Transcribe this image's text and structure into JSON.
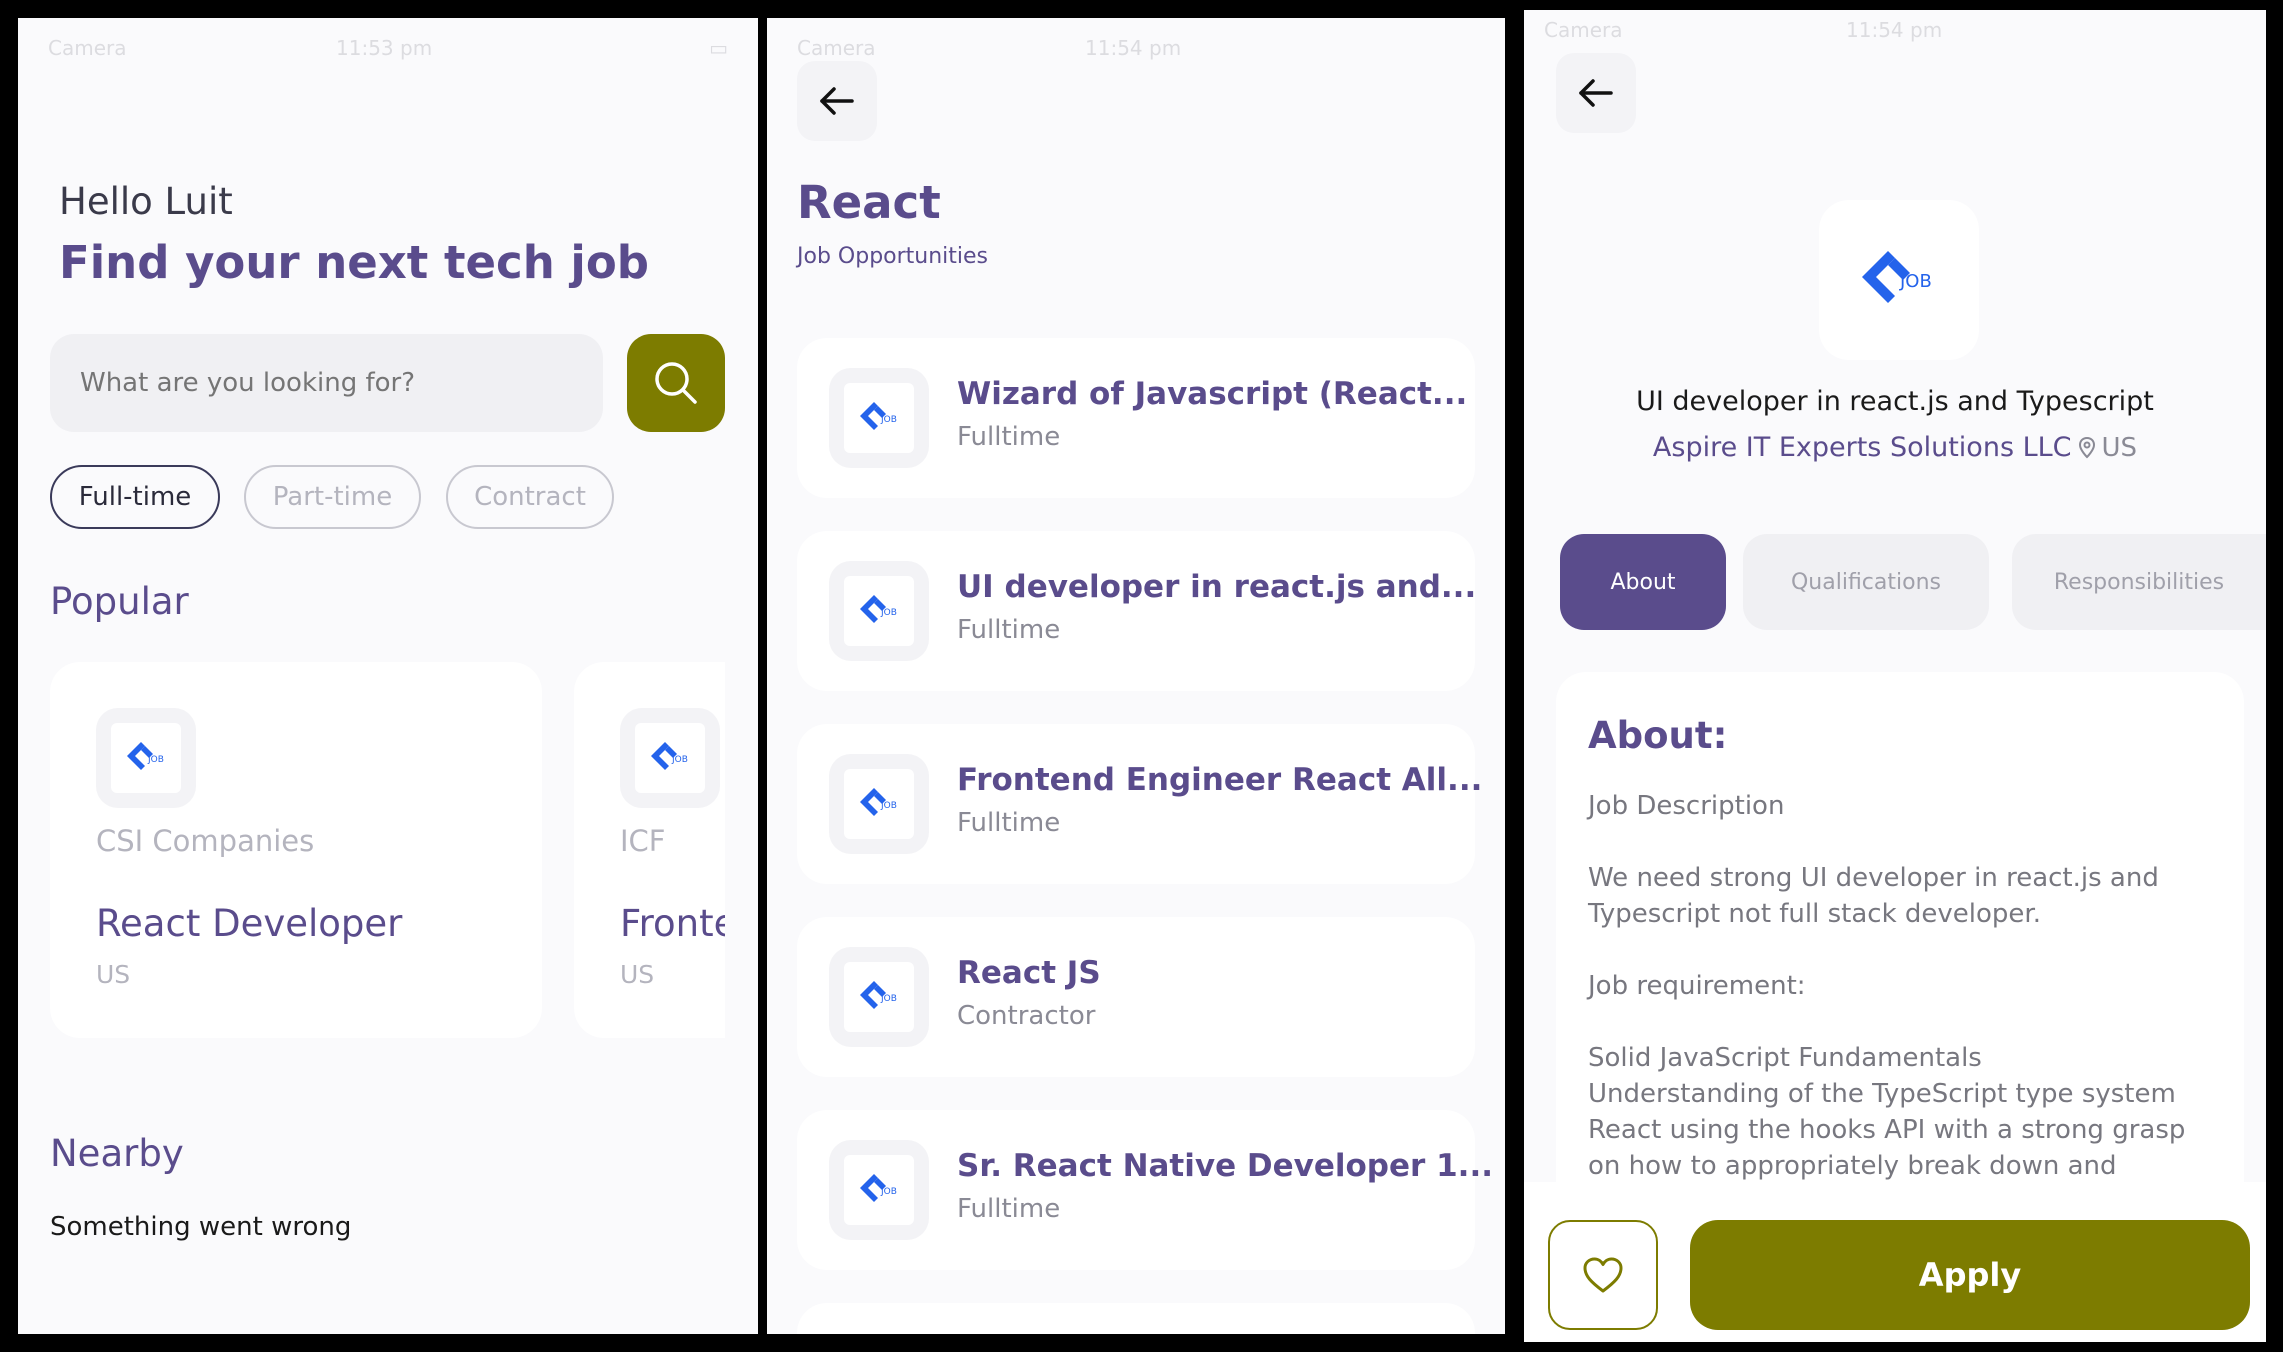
{
  "colors": {
    "primary": "#5A4C8C",
    "accent": "#7D7C00",
    "background": "#FAFAFC",
    "logo_blue": "#2463EB"
  },
  "status_bar": {
    "screen1": {
      "carrier": "Camera",
      "time": "11:53 pm"
    },
    "screen2": {
      "carrier": "Camera",
      "time": "11:54 pm"
    },
    "screen3": {
      "carrier": "Camera",
      "time": "11:54 pm"
    }
  },
  "home": {
    "greeting": "Hello Luit",
    "headline": "Find your next tech job",
    "search": {
      "placeholder": "What are you looking for?",
      "icon": "search-icon"
    },
    "filters": [
      {
        "label": "Full-time",
        "selected": true
      },
      {
        "label": "Part-time",
        "selected": false
      },
      {
        "label": "Contract",
        "selected": false
      }
    ],
    "popular_heading": "Popular",
    "popular_cards": [
      {
        "company": "CSI Companies",
        "title": "React Developer",
        "location": "US"
      },
      {
        "company": "ICF",
        "title": "Frontend",
        "location": "US"
      }
    ],
    "nearby_heading": "Nearby",
    "nearby_error": "Something went wrong"
  },
  "search_results": {
    "back_icon": "arrow-left-icon",
    "query": "React",
    "subtitle": "Job Opportunities",
    "jobs": [
      {
        "title": "Wizard of Javascript (React...",
        "type": "Fulltime"
      },
      {
        "title": "UI developer in react.js and...",
        "type": "Fulltime"
      },
      {
        "title": "Frontend Engineer  React All...",
        "type": "Fulltime"
      },
      {
        "title": "React JS",
        "type": "Contractor"
      },
      {
        "title": "Sr. React Native Developer 1...",
        "type": "Fulltime"
      }
    ]
  },
  "job_details": {
    "back_icon": "arrow-left-icon",
    "logo_text": "JOB",
    "job_title": "UI developer in react.js and Typescript",
    "company": "Aspire IT Experts Solutions LLC",
    "location": "US",
    "tabs": [
      {
        "label": "About",
        "active": true
      },
      {
        "label": "Qualifications",
        "active": false
      },
      {
        "label": "Responsibilities",
        "active": false
      }
    ],
    "about_heading": "About:",
    "about_lines": [
      "Job Description",
      "",
      "We need strong UI developer in react.js and",
      "Typescript not full stack developer.",
      "",
      "Job requirement:",
      "",
      "Solid JavaScript Fundamentals",
      "Understanding of the TypeScript type system",
      "React using the hooks API with a strong grasp",
      "on how to appropriately break down and"
    ],
    "apply_label": "Apply",
    "favorite_icon": "heart-icon"
  }
}
